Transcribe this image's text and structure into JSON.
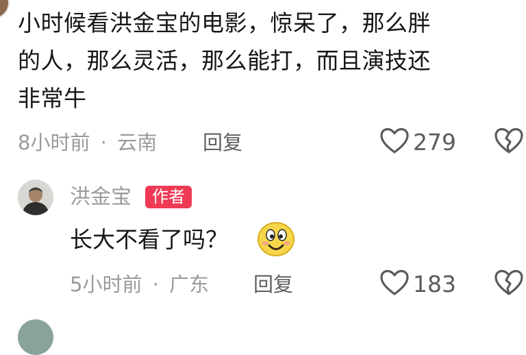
{
  "comment1": {
    "text_line1": "小时候看洪金宝的电影，惊呆了，那么胖",
    "text_line2": "的人，那么灵活，那么能打，而且演技还",
    "text_line3": "非常牛",
    "time": "8小时前",
    "separator": "·",
    "location": "云南",
    "reply_label": "回复",
    "like_count": "279"
  },
  "reply1": {
    "author": "洪金宝",
    "badge": "作者",
    "text": "长大不看了吗？",
    "time": "5小时前",
    "separator": "·",
    "location": "广东",
    "reply_label": "回复",
    "like_count": "183"
  },
  "icons": {
    "like": "heart-outline-icon",
    "dislike": "broken-heart-icon",
    "emoji": "smile-emoji-icon"
  },
  "colors": {
    "badge": "#ef3a55",
    "text": "#161616",
    "meta": "#9a9a9a"
  }
}
